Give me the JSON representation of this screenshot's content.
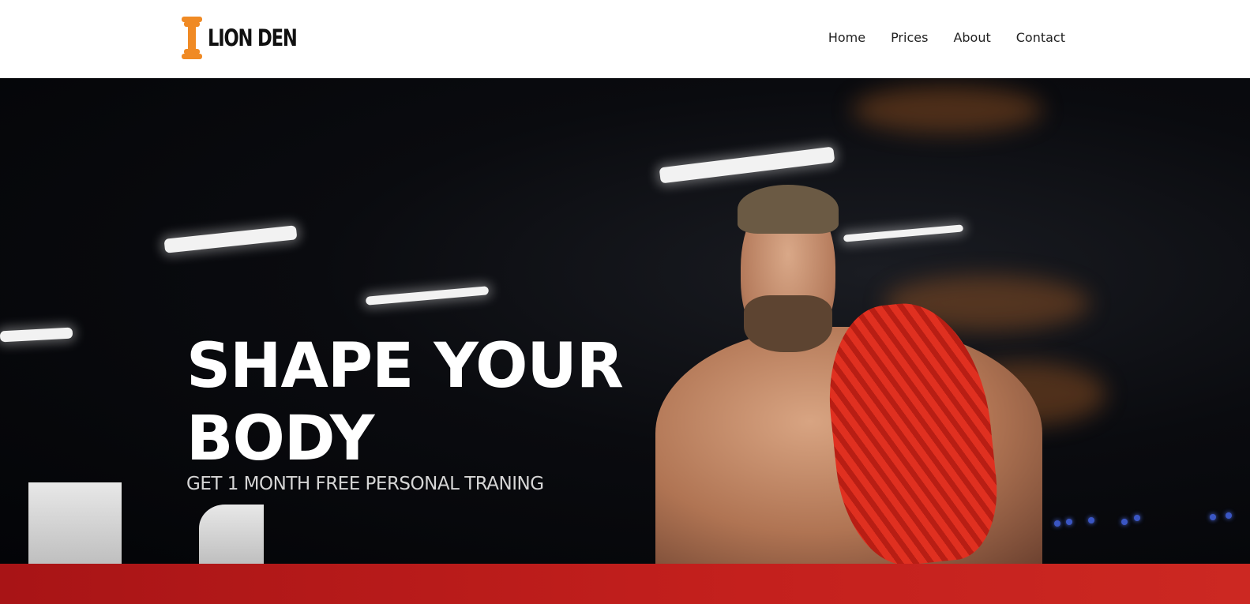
{
  "brand": {
    "name": "LION DEN",
    "logo_icon": "dumbbell-icon",
    "accent": "#f08a24"
  },
  "nav": {
    "items": [
      "Home",
      "Prices",
      "About",
      "Contact"
    ]
  },
  "hero": {
    "title": "SHAPE YOUR BODY",
    "subtitle": "GET 1 MONTH FREE PERSONAL TRANING"
  },
  "colors": {
    "band": "#c01d1b",
    "header_bg": "#ffffff",
    "hero_bg": "#05060a"
  }
}
